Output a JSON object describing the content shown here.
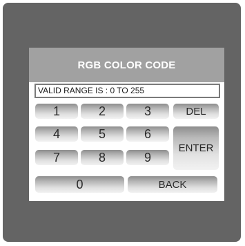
{
  "dialog": {
    "title": "RGB COLOR CODE",
    "range_text": "VALID RANGE IS : 0 TO 255"
  },
  "keypad": {
    "key_1": "1",
    "key_2": "2",
    "key_3": "3",
    "key_4": "4",
    "key_5": "5",
    "key_6": "6",
    "key_7": "7",
    "key_8": "8",
    "key_9": "9",
    "key_0": "0",
    "del": "DEL",
    "enter": "ENTER",
    "back": "BACK"
  },
  "colors": {
    "panel": "#646464",
    "title_bar": "#a1a1a1",
    "dialog": "#ffffff"
  }
}
